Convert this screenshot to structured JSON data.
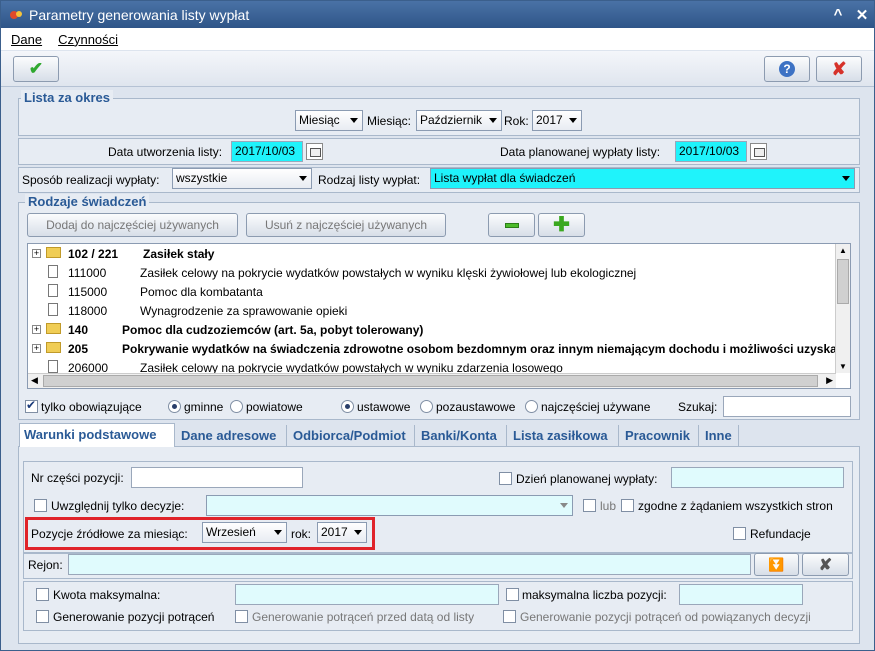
{
  "window": {
    "title": "Parametry generowania listy wypłat",
    "minimize": "^",
    "close": "✕"
  },
  "menu": [
    {
      "label": "Dane"
    },
    {
      "label": "Czynności"
    }
  ],
  "lista_za_okres": {
    "legend": "Lista za okres",
    "period_type": "Miesiąc",
    "month_label": "Miesiąc:",
    "month": "Październik",
    "year_label": "Rok:",
    "year": "2017"
  },
  "dates": {
    "created_label": "Data utworzenia listy:",
    "created": "2017/10/03",
    "planned_label": "Data planowanej wypłaty listy:",
    "planned": "2017/10/03"
  },
  "realizacja": {
    "label": "Sposób realizacji wypłaty:",
    "value": "wszystkie",
    "rodzaj_label": "Rodzaj listy wypłat:",
    "rodzaj_value": "Lista wypłat dla świadczeń"
  },
  "rodzaje": {
    "legend": "Rodzaje świadczeń",
    "add_btn": "Dodaj do najczęściej używanych",
    "remove_btn": "Usuń z najczęściej używanych",
    "rows": [
      {
        "code": "102 / 221",
        "name": "Zasiłek stały",
        "folder": true,
        "bold": true
      },
      {
        "code": "111000",
        "name": "Zasiłek celowy na pokrycie wydatków powstałych w wyniku klęski żywiołowej lub ekologicznej",
        "folder": false,
        "bold": false
      },
      {
        "code": "115000",
        "name": "Pomoc dla kombatanta",
        "folder": false,
        "bold": false
      },
      {
        "code": "118000",
        "name": "Wynagrodzenie za sprawowanie opieki",
        "folder": false,
        "bold": false
      },
      {
        "code": "140",
        "name": "Pomoc dla cudzoziemców (art. 5a, pobyt tolerowany)",
        "folder": true,
        "bold": true
      },
      {
        "code": "205",
        "name": "Pokrywanie wydatków na świadczenia zdrowotne osobom bezdomnym oraz innym niemającym dochodu i możliwości uzyskan",
        "folder": true,
        "bold": true
      },
      {
        "code": "206000",
        "name": "Zasiłek celowy na pokrycie wydatków powstałych w wyniku zdarzenia losowego",
        "folder": false,
        "bold": false
      }
    ]
  },
  "filters": {
    "tylko": "tylko obowiązujące",
    "gminne": "gminne",
    "powiatowe": "powiatowe",
    "ustawowe": "ustawowe",
    "pozaustawowe": "pozaustawowe",
    "najczesciej": "najczęściej używane",
    "szukaj": "Szukaj:"
  },
  "tabs": [
    {
      "label": "Warunki podstawowe"
    },
    {
      "label": "Dane adresowe"
    },
    {
      "label": "Odbiorca/Podmiot"
    },
    {
      "label": "Banki/Konta"
    },
    {
      "label": "Lista zasiłkowa"
    },
    {
      "label": "Pracownik"
    },
    {
      "label": "Inne"
    }
  ],
  "warunki": {
    "nr_czesci": "Nr części pozycji:",
    "dzien_planowanej": "Dzień planowanej wypłaty:",
    "uwzglednij": "Uwzględnij tylko decyzje:",
    "lub": "lub",
    "zgodne": "zgodne z żądaniem wszystkich stron",
    "pozycje_label": "Pozycje źródłowe za miesiąc:",
    "pozycje_month": "Wrzesień",
    "rok_label": "rok:",
    "rok": "2017",
    "refundacje": "Refundacje",
    "rejon": "Rejon:",
    "kwota": "Kwota maksymalna:",
    "maks_liczba": "maksymalna liczba pozycji:",
    "gen_potracen": "Generowanie pozycji potrąceń",
    "gen_przed": "Generowanie potrąceń przed datą od listy",
    "gen_od_powiazanych": "Generowanie pozycji potrąceń od powiązanych decyzji"
  },
  "colors": {
    "accent": "#2a5a96",
    "highlight": "#1ff3fb",
    "red_frame": "#e0232a"
  }
}
